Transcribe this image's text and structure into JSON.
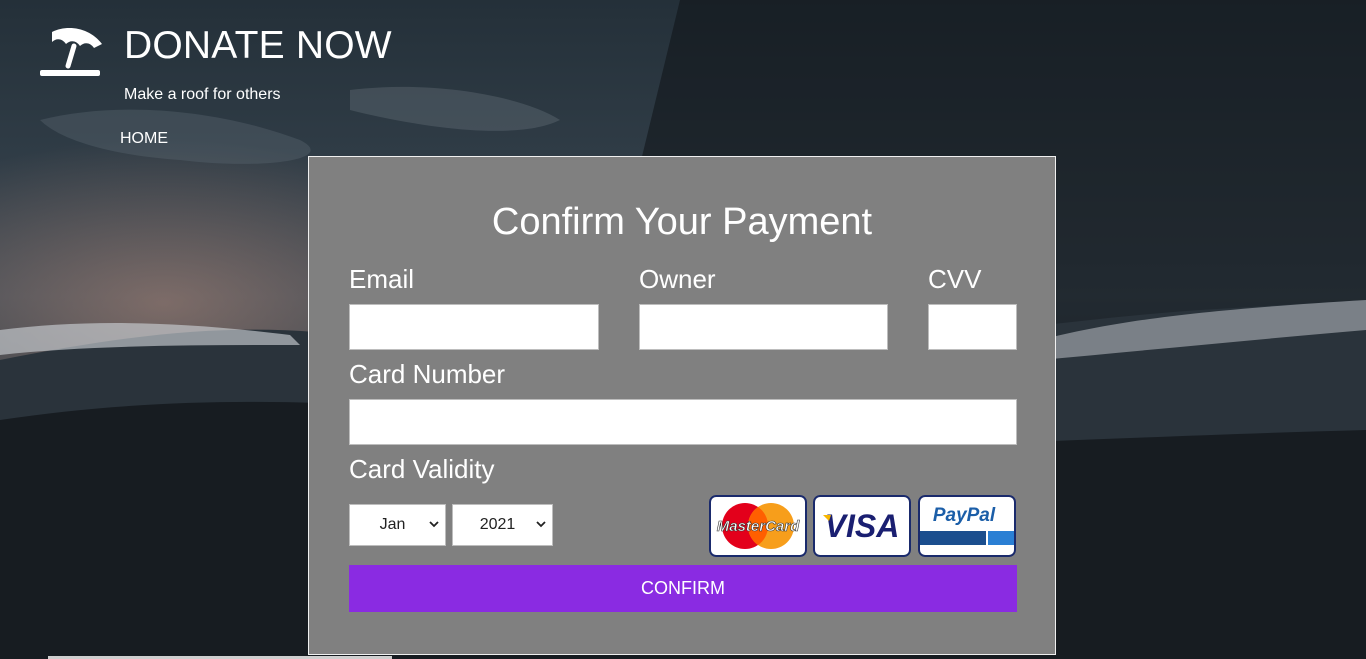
{
  "header": {
    "title": "DONATE NOW",
    "tagline": "Make a roof for others",
    "nav": {
      "home": "HOME"
    },
    "logo_icon": "umbrella-icon"
  },
  "form": {
    "title": "Confirm Your Payment",
    "email_label": "Email",
    "owner_label": "Owner",
    "cvv_label": "CVV",
    "card_number_label": "Card Number",
    "validity_label": "Card Validity",
    "month": "Jan",
    "year": "2021",
    "confirm_label": "CONFIRM"
  },
  "payment_logos": {
    "mastercard": "MasterCard",
    "visa": "VISA",
    "paypal": "PayPal"
  },
  "colors": {
    "accent": "#8a2be2",
    "panel": "#808080"
  }
}
